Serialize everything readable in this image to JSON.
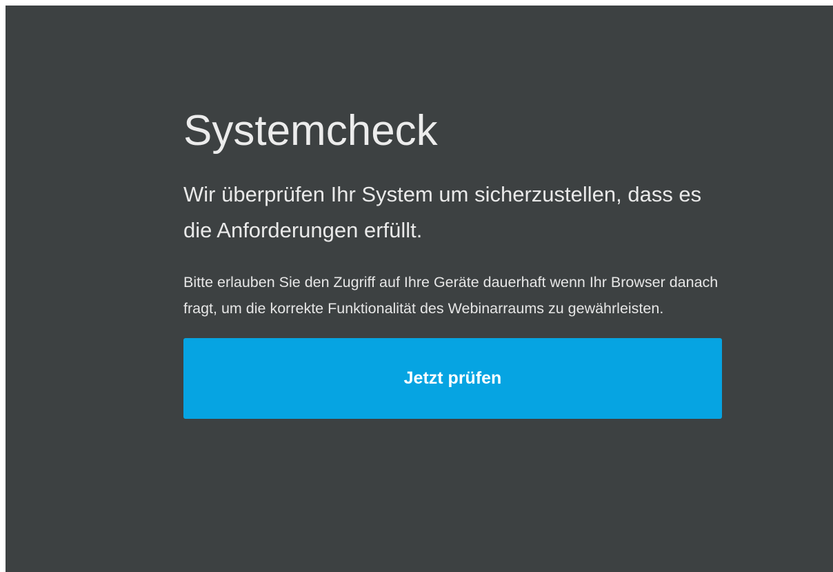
{
  "systemcheck": {
    "title": "Systemcheck",
    "subtitle": "Wir überprüfen Ihr System um sicherzustellen, dass es die Anforderungen erfüllt.",
    "description": "Bitte erlauben Sie den Zugriff auf Ihre Geräte dauerhaft wenn Ihr Browser danach fragt, um die korrekte Funktionalität des Webinarraums zu gewährleisten.",
    "button_label": "Jetzt prüfen"
  },
  "colors": {
    "background": "#3d4142",
    "button": "#06a4e2",
    "text": "#ececec"
  }
}
